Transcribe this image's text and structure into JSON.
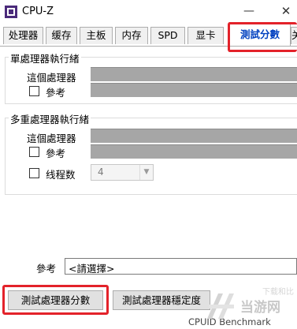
{
  "window": {
    "title": "CPU-Z",
    "min_glyph": "—",
    "close_glyph": "✕"
  },
  "tabs": [
    {
      "label": "处理器"
    },
    {
      "label": "缓存"
    },
    {
      "label": "主板"
    },
    {
      "label": "内存"
    },
    {
      "label": "SPD"
    },
    {
      "label": "显卡"
    },
    {
      "label": "測試分數",
      "active": true
    },
    {
      "label": "关"
    }
  ],
  "single_thread": {
    "title": "單處理器執行緒",
    "this_cpu_label": "這個處理器",
    "reference_label": "參考"
  },
  "multi_thread": {
    "title": "多重處理器執行緒",
    "this_cpu_label": "這個處理器",
    "reference_label": "參考",
    "threads_label": "线程数",
    "threads_value": "4"
  },
  "reference": {
    "label": "參考",
    "select_value": "<請選擇>"
  },
  "buttons": {
    "bench_cpu": "測試處理器分數",
    "stress_cpu": "測試處理器穩定度"
  },
  "footer": {
    "text": "CPUID Benchmark"
  },
  "watermark": {
    "text": "当游网",
    "sub": "下载和比"
  },
  "colors": {
    "highlight": "#e3222a",
    "active_tab_text": "#0040c0",
    "bar": "#a6a6a6"
  }
}
